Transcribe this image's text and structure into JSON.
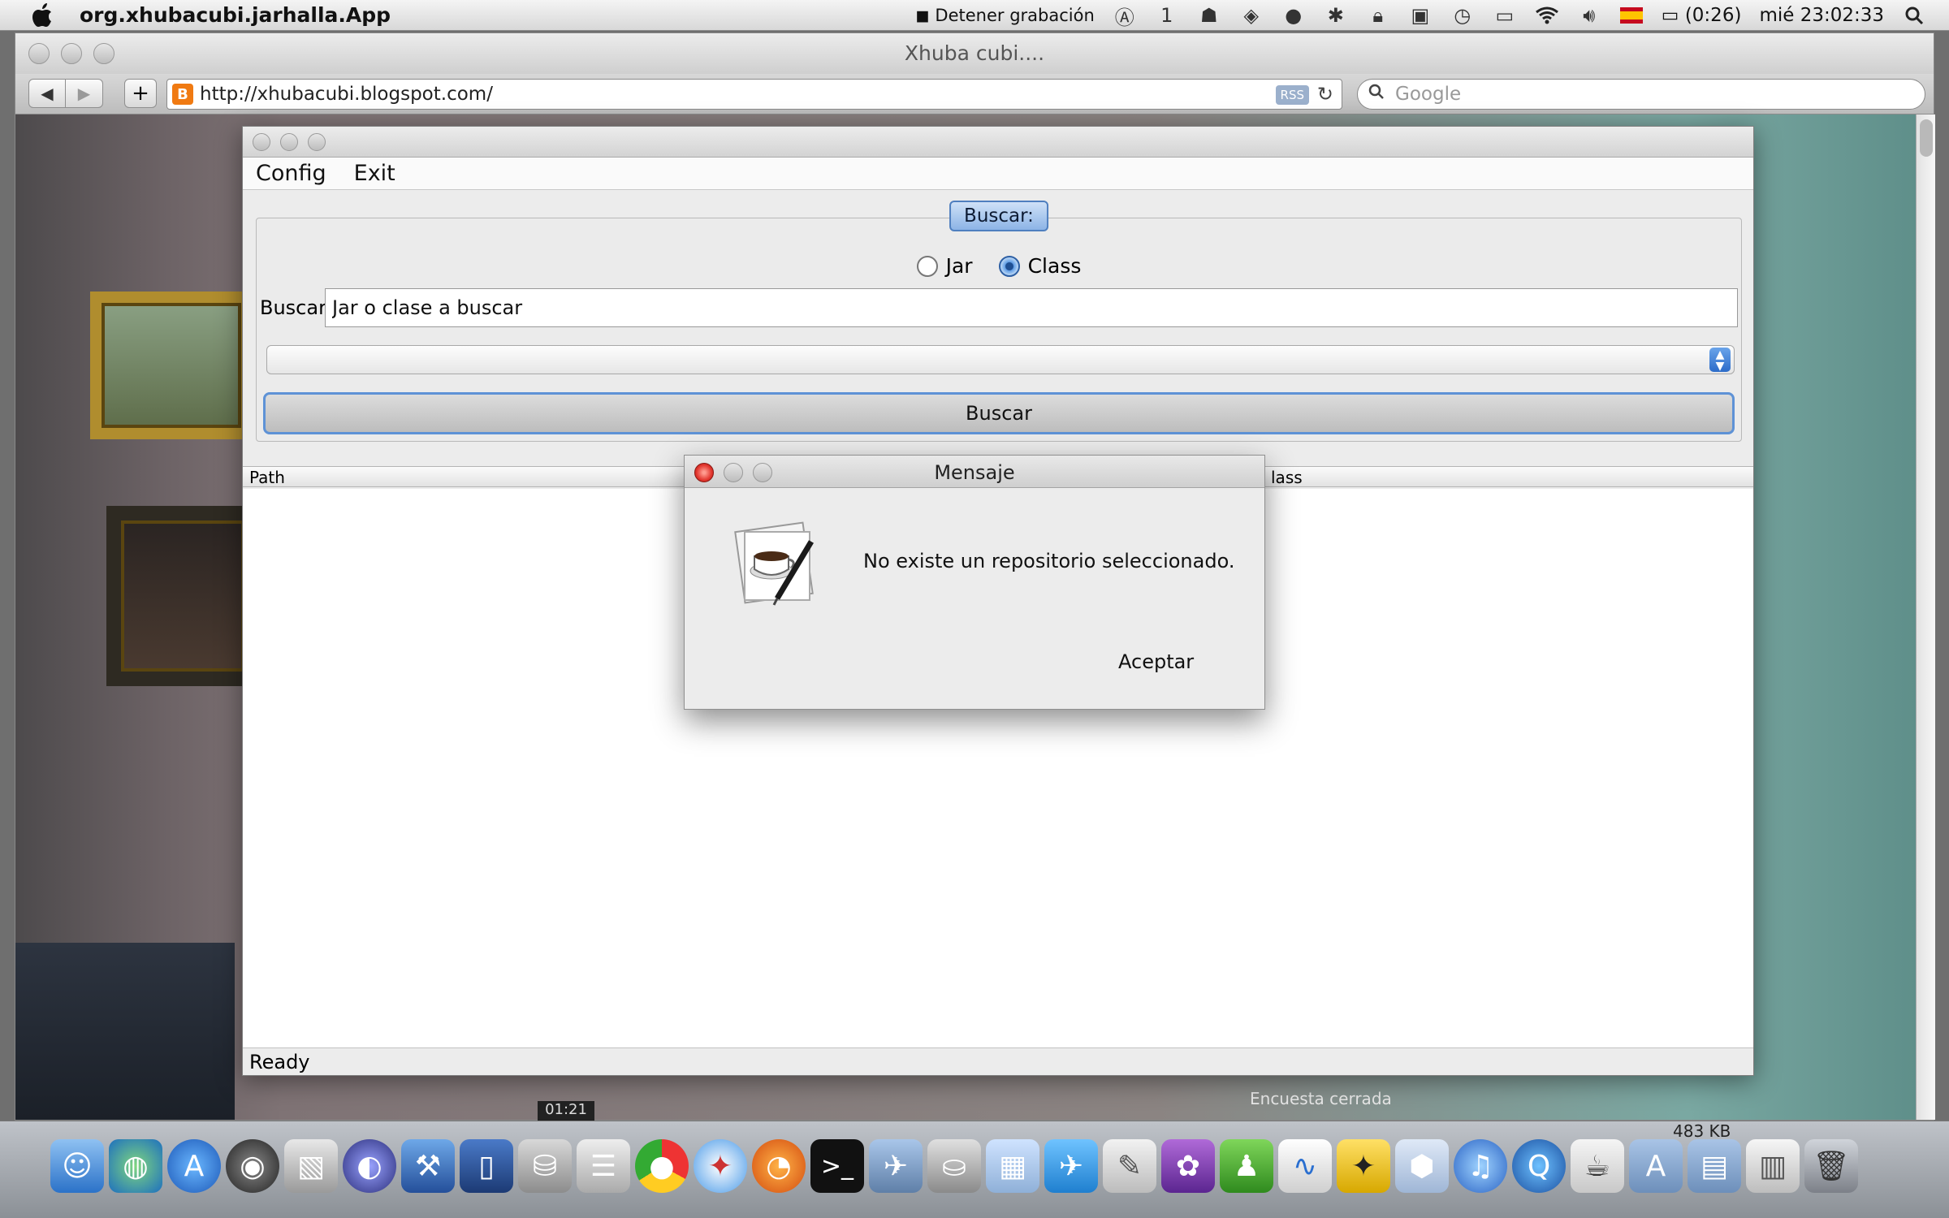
{
  "menubar": {
    "app_name": "org.xhubacubi.jarhalla.App",
    "recording_label": "Detener grabación",
    "spaces": "1",
    "battery": "(0:26)",
    "clock": "mié 23:02:33"
  },
  "browser": {
    "title": "Xhuba cubi....",
    "url": "http://xhubacubi.blogspot.com/",
    "rss": "RSS",
    "search_placeholder": "Google"
  },
  "blog": {
    "poll_closed": "Encuesta cerrada",
    "video_time": "01:21"
  },
  "app": {
    "menu": [
      "Config",
      "Exit"
    ],
    "panel_title": "Buscar:",
    "radios": [
      {
        "label": "Jar",
        "selected": false
      },
      {
        "label": "Class",
        "selected": true
      }
    ],
    "search_label": "Buscar",
    "search_value": "Jar o clase a buscar",
    "button_label": "Buscar",
    "columns": [
      "Path",
      "lass"
    ],
    "status": "Ready"
  },
  "dialog": {
    "title": "Mensaje",
    "message": "No existe un repositorio seleccionado.",
    "button": "Aceptar"
  },
  "dock": {
    "labels": [
      "483 KB"
    ]
  },
  "colors": {
    "accent_blue": "#5e92d6",
    "close_red": "#e2362e",
    "blogger_orange": "#f07a12"
  }
}
